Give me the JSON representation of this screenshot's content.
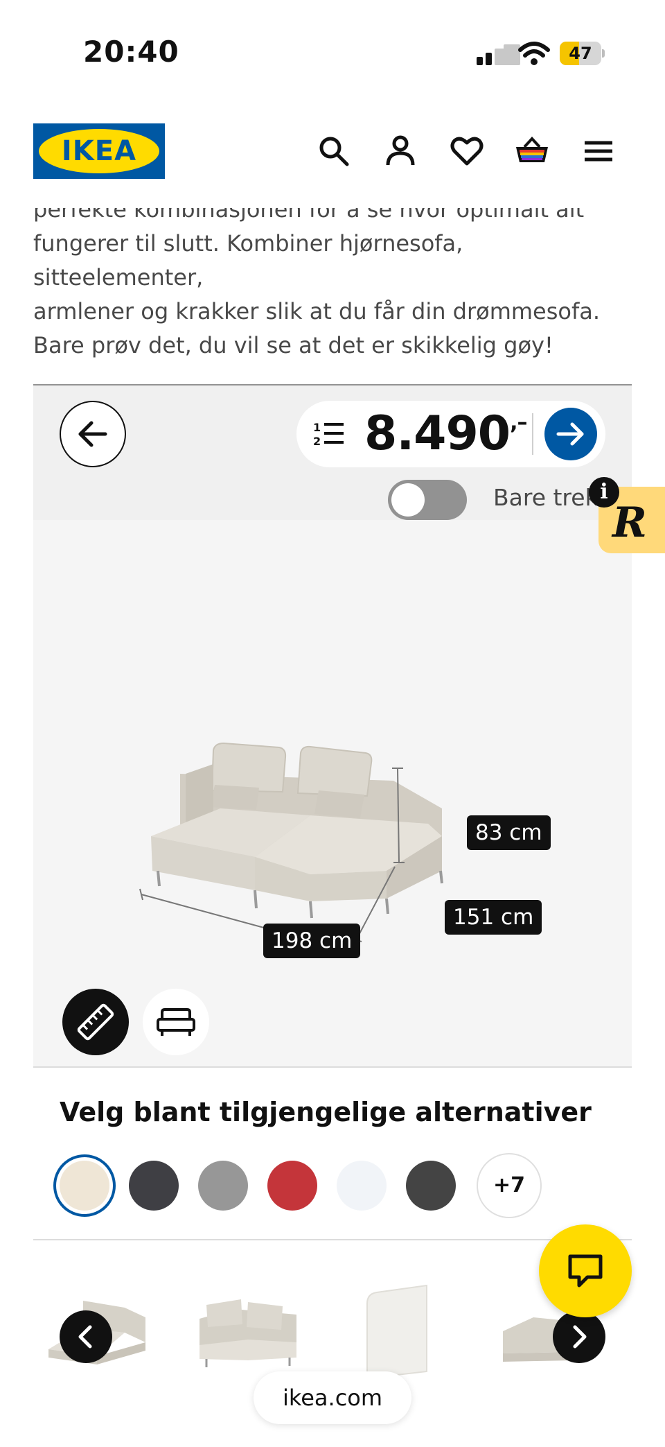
{
  "status_bar": {
    "time": "20:40",
    "battery": "47",
    "battery_level": 0.47
  },
  "header": {
    "logo_text": "IKEA",
    "icons": [
      "search-icon",
      "account-icon",
      "heart-icon",
      "basket-icon",
      "menu-icon"
    ]
  },
  "intro": {
    "lines": [
      "perfekte kombinasjonen for å se hvor optimalt alt",
      "fungerer til slutt. Kombiner hjørnesofa, sitteelementer,",
      "armlener og krakker slik at du får din drømmesofa.",
      "Bare prøv det, du vil se at det er skikkelig gøy!"
    ]
  },
  "configurator": {
    "price": "8.490",
    "price_suffix": ",–",
    "toggle_label": "Bare trekk",
    "toggle_on": false,
    "dimensions": {
      "height": "83 cm",
      "depth": "151 cm",
      "width": "198 cm"
    }
  },
  "options": {
    "title": "Velg blant tilgjengelige alternativer",
    "swatches": [
      "#efe6d6",
      "#3f3f44",
      "#979797",
      "#c4353a",
      "#f1f4f8",
      "#444444"
    ],
    "selected_index": 0,
    "more_label": "+7"
  },
  "footer": {
    "url": "ikea.com"
  },
  "colors": {
    "ikea_blue": "#0058a3",
    "ikea_yellow": "#ffdb00"
  }
}
